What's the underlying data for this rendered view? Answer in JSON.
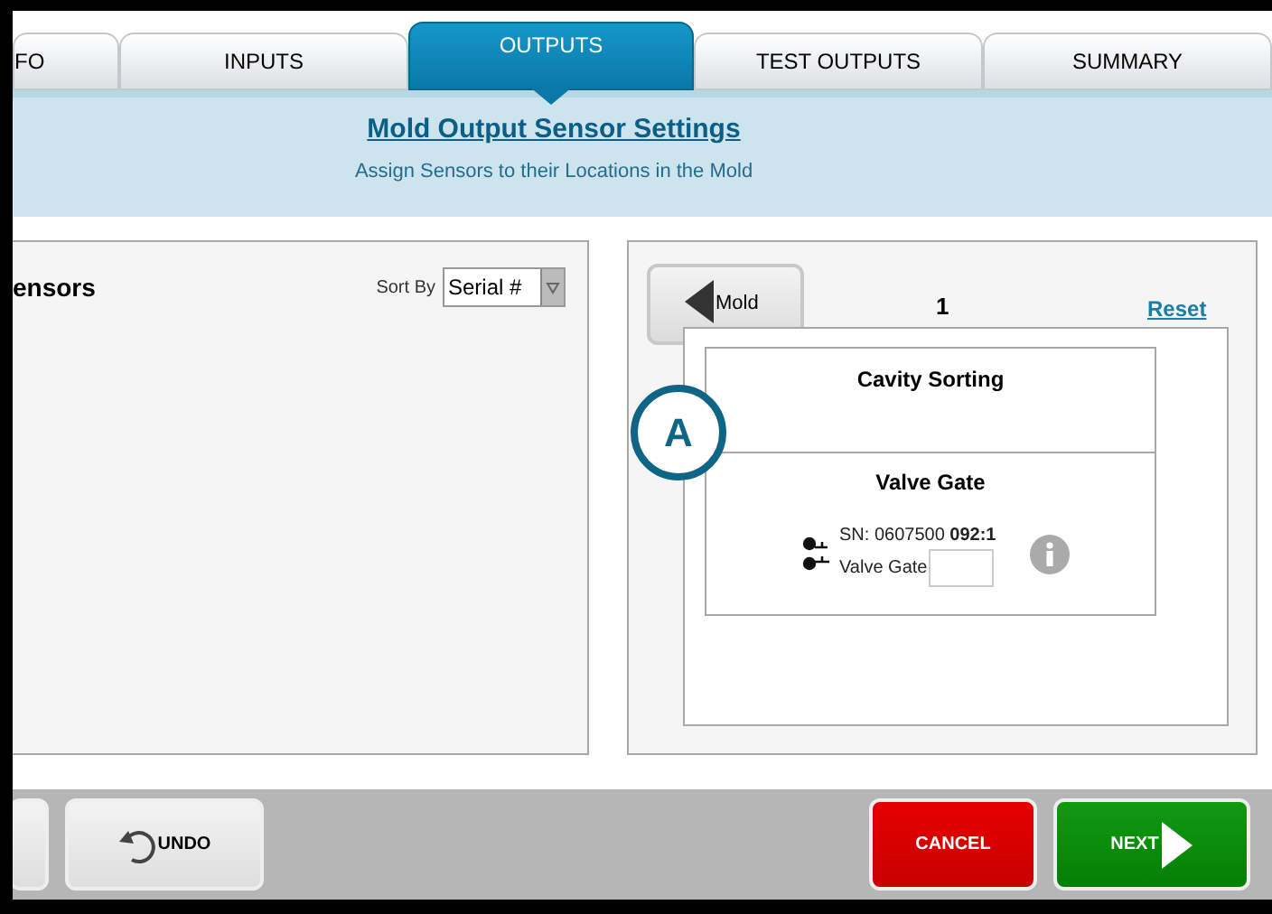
{
  "tabs": [
    {
      "label": "FO",
      "selected": false
    },
    {
      "label": "INPUTS",
      "selected": false
    },
    {
      "label": "OUTPUTS",
      "selected": true
    },
    {
      "label": "TEST OUTPUTS",
      "selected": false
    },
    {
      "label": "SUMMARY",
      "selected": false
    }
  ],
  "header": {
    "title": "Mold Output Sensor Settings",
    "subtitle": "Assign Sensors to their Locations in the Mold"
  },
  "sensors_panel": {
    "title": "ensors",
    "sort_label": "Sort By",
    "sort_value": "Serial #"
  },
  "mold_panel": {
    "back_button": "Mold",
    "number": "1",
    "reset_link": "Reset",
    "groups": [
      {
        "title": "Cavity Sorting"
      },
      {
        "title": "Valve Gate",
        "sensors": [
          {
            "serial_prefix": "SN: 0607500",
            "serial_suffix": "092:1",
            "type": "Valve Gate"
          }
        ]
      }
    ]
  },
  "callout": "A",
  "footer": {
    "buttons": [
      {
        "kind": "partial"
      },
      {
        "kind": "undo",
        "label": "UNDO"
      },
      {
        "kind": "cancel",
        "label": "CANCEL"
      },
      {
        "kind": "next",
        "label": "NEXT"
      }
    ]
  }
}
